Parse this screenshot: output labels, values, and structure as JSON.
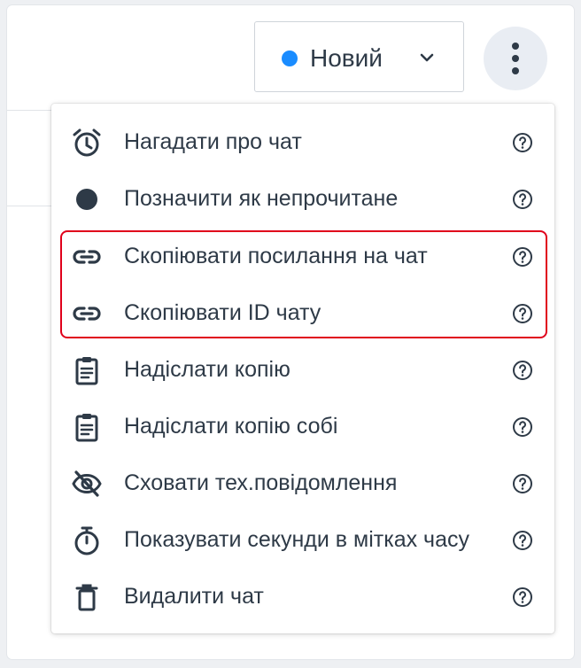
{
  "header": {
    "status": {
      "label": "Новий",
      "dot_color": "#1a8cff",
      "icon": "chevron-down-icon"
    },
    "more_menu_icon": "more-vertical-icon"
  },
  "menu": {
    "items": [
      {
        "label": "Нагадати про чат",
        "icon": "alarm-clock-icon"
      },
      {
        "label": "Позначити як непрочитане",
        "icon": "filled-circle-icon"
      },
      {
        "label": "Скопіювати посилання на чат",
        "icon": "link-icon"
      },
      {
        "label": "Скопіювати ID чату",
        "icon": "link-icon"
      },
      {
        "label": "Надіслати копію",
        "icon": "clipboard-icon"
      },
      {
        "label": "Надіслати копію собі",
        "icon": "clipboard-icon"
      },
      {
        "label": "Сховати тех.повідомлення",
        "icon": "eye-off-icon"
      },
      {
        "label": "Показувати секунди в мітках часу",
        "icon": "stopwatch-icon"
      },
      {
        "label": "Видалити чат",
        "icon": "trash-icon"
      }
    ],
    "help_icon": "help-circle-icon",
    "highlight_color": "#e0001b"
  },
  "colors": {
    "text": "#2e3a47",
    "icon": "#2e3a47",
    "accent": "#1a8cff"
  }
}
